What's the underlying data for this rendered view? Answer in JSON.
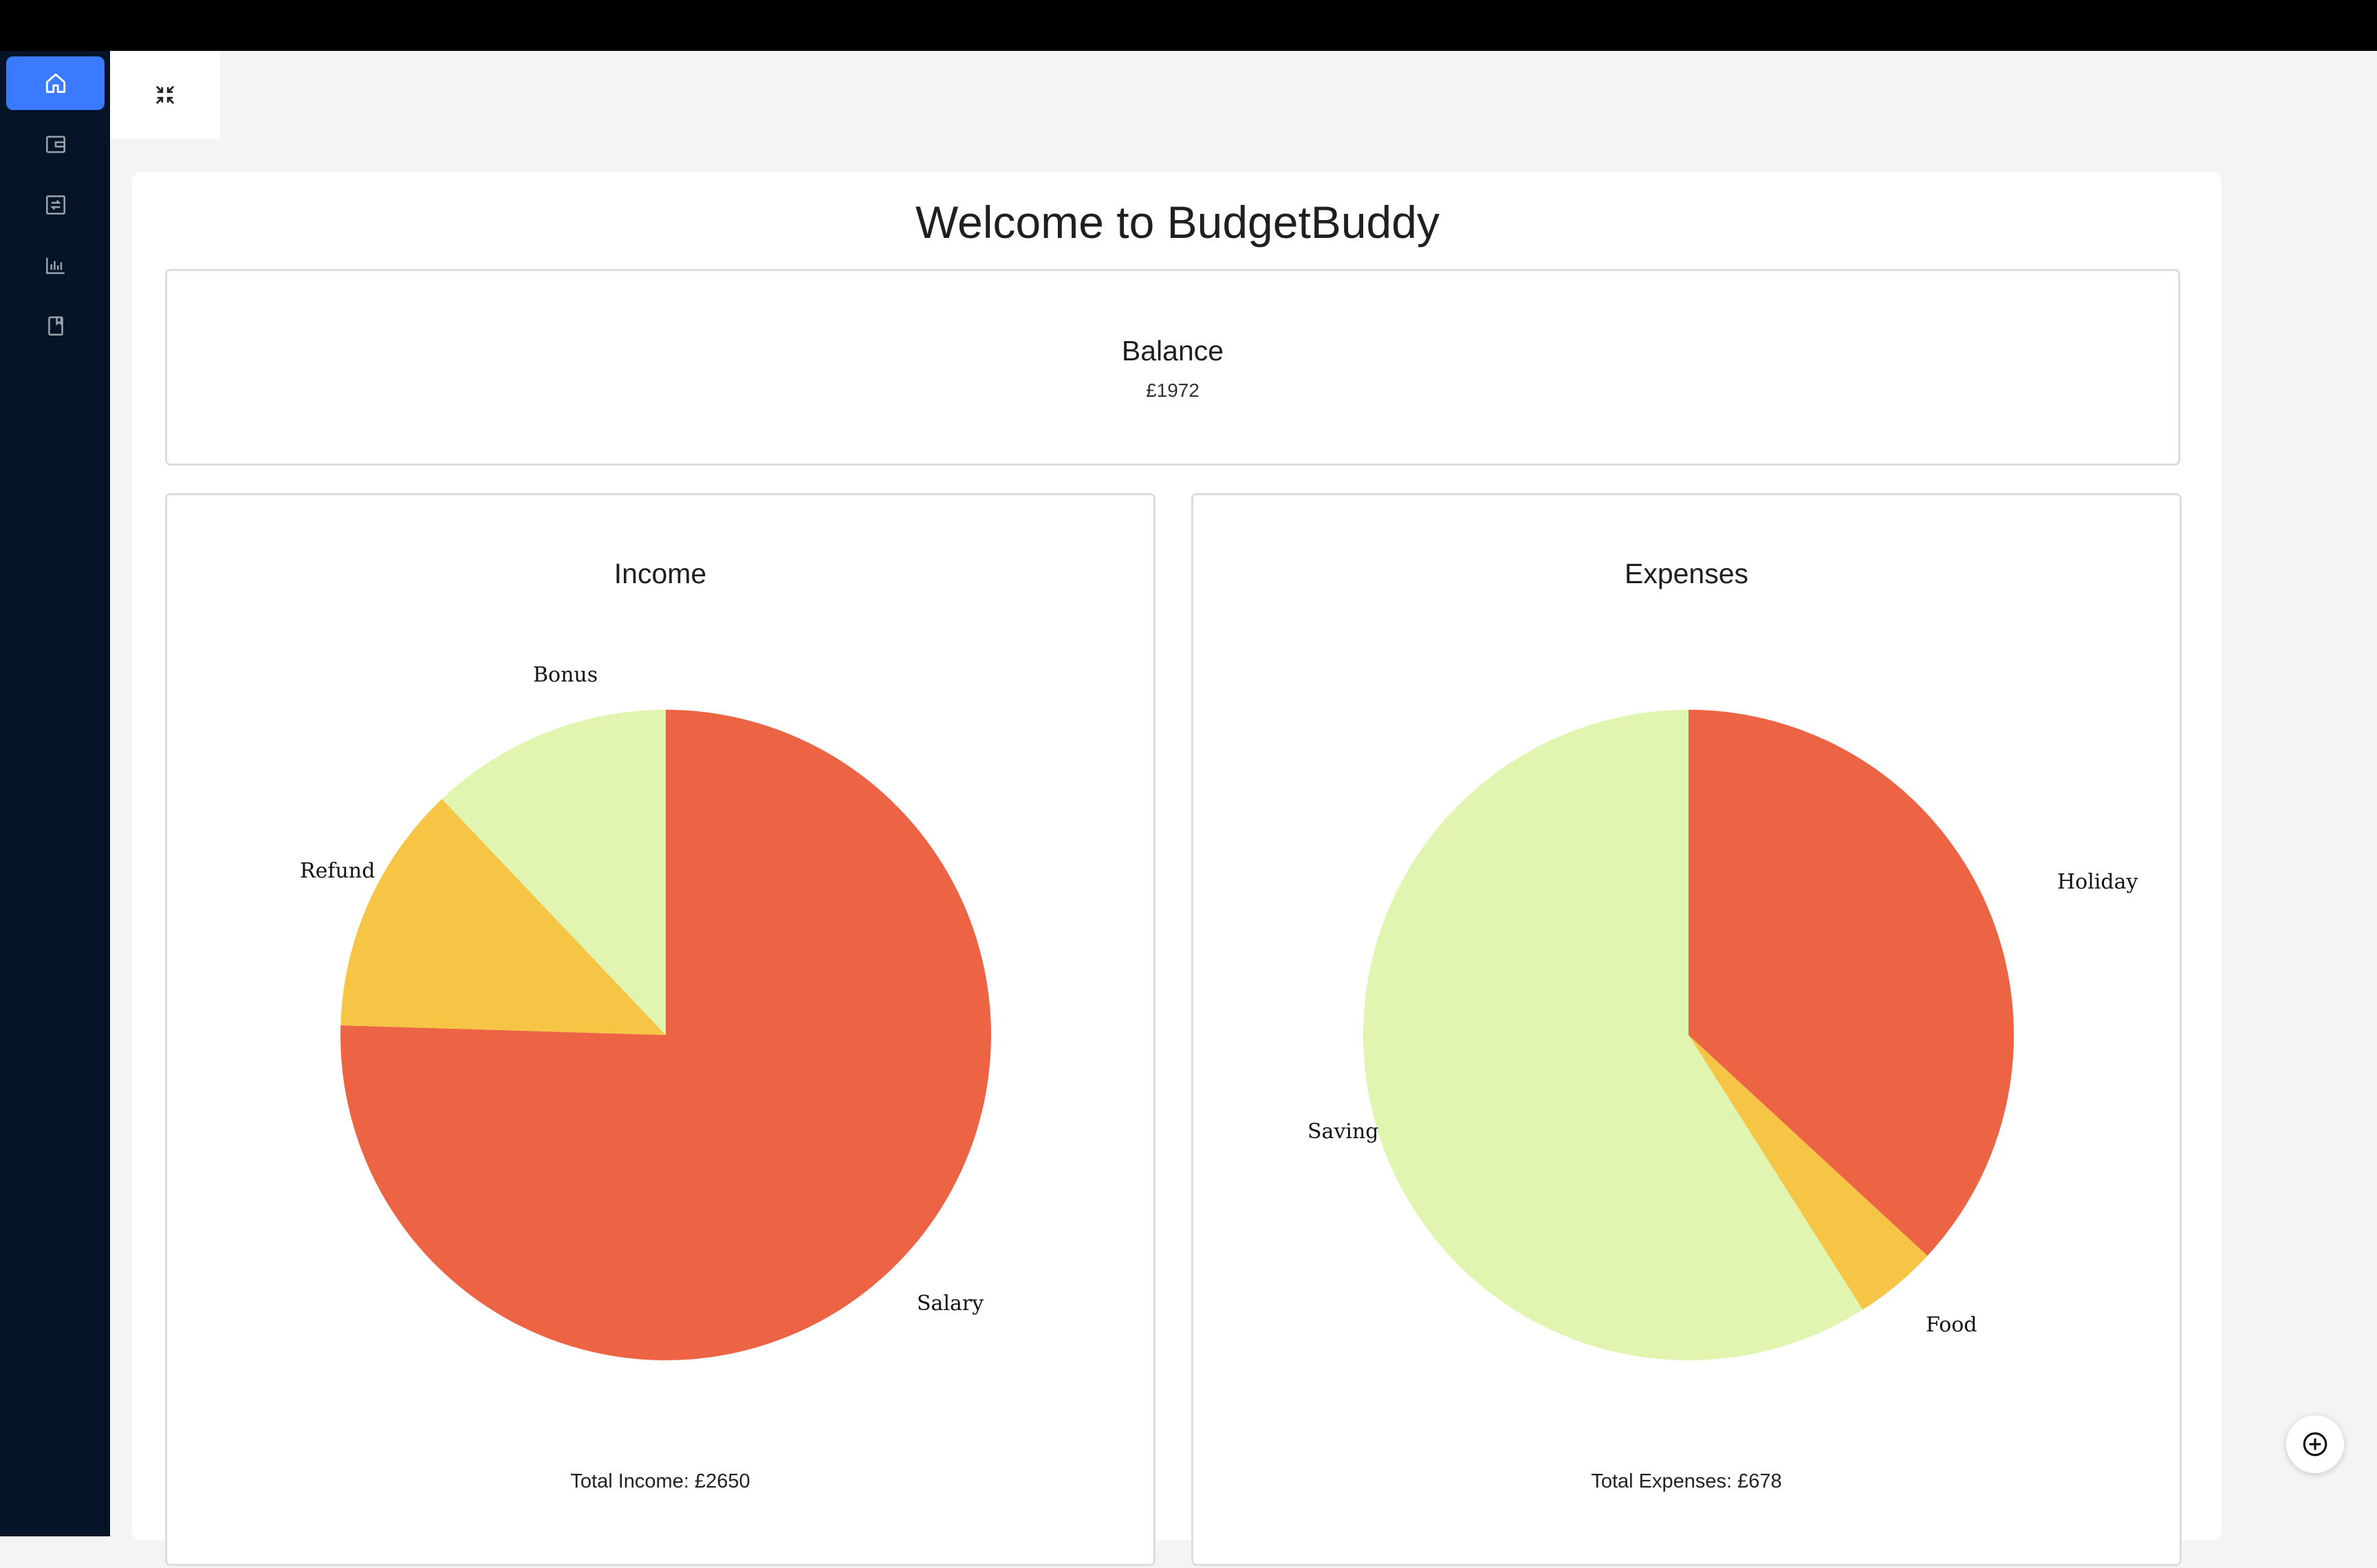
{
  "app": {
    "title": "Welcome to BudgetBuddy"
  },
  "sidebar": {
    "items": [
      {
        "icon": "home-icon",
        "active": true
      },
      {
        "icon": "wallet-icon",
        "active": false
      },
      {
        "icon": "transfer-icon",
        "active": false
      },
      {
        "icon": "bar-chart-icon",
        "active": false
      },
      {
        "icon": "book-icon",
        "active": false
      }
    ]
  },
  "toolbar": {
    "collapse_icon": "collapse-icon"
  },
  "balance": {
    "title": "Balance",
    "value": "£1972"
  },
  "income": {
    "title": "Income",
    "total": "Total Income: £2650"
  },
  "expenses": {
    "title": "Expenses",
    "total": "Total Expenses: £678"
  },
  "fab": {
    "icon": "plus-circle-icon"
  },
  "colors": {
    "accent": "#3a7afe",
    "sidebar": "#051426",
    "slice_1": "#ec6443",
    "slice_2": "#f6c545",
    "slice_3": "#e0f5b0"
  },
  "chart_data": [
    {
      "type": "pie",
      "title": "Income",
      "categories": [
        "Salary",
        "Refund",
        "Bonus"
      ],
      "values": [
        2000,
        330,
        320
      ],
      "colors": [
        "#ec6443",
        "#f6c545",
        "#e0f5b0"
      ]
    },
    {
      "type": "pie",
      "title": "Expenses",
      "categories": [
        "Holiday",
        "Food",
        "Saving"
      ],
      "values": [
        250,
        28,
        400
      ],
      "colors": [
        "#ec6443",
        "#f6c545",
        "#e0f5b0"
      ]
    }
  ]
}
